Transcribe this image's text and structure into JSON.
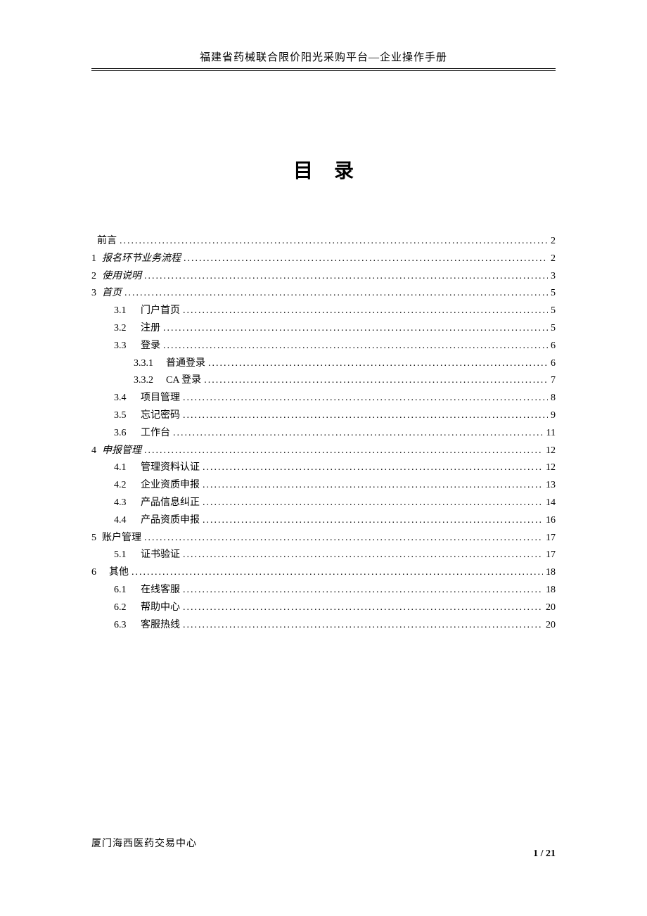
{
  "header": "福建省药械联合限价阳光采购平台—企业操作手册",
  "toc_title": "目录",
  "toc": [
    {
      "level": 0,
      "num": "",
      "label": "前言",
      "page": "2"
    },
    {
      "level": 0,
      "num": "1",
      "label": "报名环节业务流程",
      "page": "2",
      "italic": true
    },
    {
      "level": 0,
      "num": "2",
      "label": "使用说明",
      "page": "3",
      "italic": true
    },
    {
      "level": 0,
      "num": "3",
      "label": "首页",
      "page": "5",
      "italic": true
    },
    {
      "level": 1,
      "num": "3.1",
      "label": "门户首页",
      "page": "5"
    },
    {
      "level": 1,
      "num": "3.2",
      "label": "注册",
      "page": "5"
    },
    {
      "level": 1,
      "num": "3.3",
      "label": "登录",
      "page": "6"
    },
    {
      "level": 2,
      "num": "3.3.1",
      "label": "普通登录",
      "page": "6"
    },
    {
      "level": 2,
      "num": "3.3.2",
      "label": "CA 登录",
      "page": "7"
    },
    {
      "level": 1,
      "num": "3.4",
      "label": "项目管理",
      "page": "8"
    },
    {
      "level": 1,
      "num": "3.5",
      "label": "忘记密码",
      "page": "9"
    },
    {
      "level": 1,
      "num": "3.6",
      "label": "工作台",
      "page": "11"
    },
    {
      "level": 0,
      "num": "4",
      "label": "申报管理",
      "page": "12",
      "italic": true
    },
    {
      "level": 1,
      "num": "4.1",
      "label": "管理资料认证",
      "page": "12"
    },
    {
      "level": 1,
      "num": "4.2",
      "label": "企业资质申报",
      "page": "13"
    },
    {
      "level": 1,
      "num": "4.3",
      "label": "产品信息纠正",
      "page": "14"
    },
    {
      "level": 1,
      "num": "4.4",
      "label": "产品资质申报",
      "page": "16"
    },
    {
      "level": 0,
      "num": "5",
      "label": "账户管理",
      "page": "17"
    },
    {
      "level": 1,
      "num": "5.1",
      "label": "证书验证",
      "page": "17"
    },
    {
      "level": 0,
      "num": "6",
      "label": "其他",
      "page": "18",
      "spaced": true
    },
    {
      "level": 1,
      "num": "6.1",
      "label": "在线客服",
      "page": "18"
    },
    {
      "level": 1,
      "num": "6.2",
      "label": "帮助中心",
      "page": "20"
    },
    {
      "level": 1,
      "num": "6.3",
      "label": "客服热线",
      "page": "20"
    }
  ],
  "footer_left": "厦门海西医药交易中心",
  "footer_right": "1 / 21"
}
